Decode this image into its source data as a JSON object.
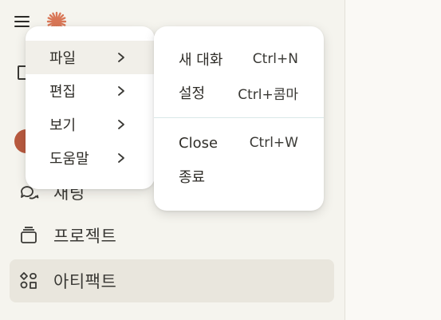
{
  "colors": {
    "accent": "#d97757",
    "sidebar_bg": "#f5f4ee",
    "menu_bg": "#ffffff",
    "active_item_bg": "#e9e6dd"
  },
  "top_bar": {
    "menu_icon": "hamburger-icon",
    "logo_icon": "asterisk-logo"
  },
  "sidebar": {
    "items": [
      {
        "label": "채팅",
        "icon": "chat-bubbles-icon"
      },
      {
        "label": "프로젝트",
        "icon": "box-icon"
      },
      {
        "label": "아티팩트",
        "icon": "shapes-icon"
      }
    ]
  },
  "main_menu": {
    "items": [
      {
        "label": "파일"
      },
      {
        "label": "편집"
      },
      {
        "label": "보기"
      },
      {
        "label": "도움말"
      }
    ]
  },
  "file_submenu": {
    "items": [
      {
        "label": "새 대화",
        "shortcut": "Ctrl+N"
      },
      {
        "label": "설정",
        "shortcut": "Ctrl+콤마"
      },
      {
        "label": "Close",
        "shortcut": "Ctrl+W"
      },
      {
        "label": "종료",
        "shortcut": ""
      }
    ]
  }
}
